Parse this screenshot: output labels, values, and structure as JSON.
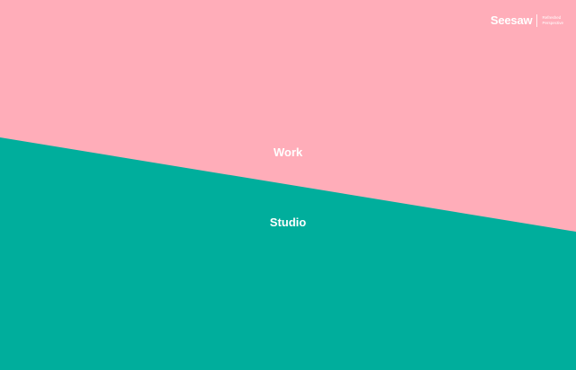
{
  "colors": {
    "pink": "#ffadb9",
    "teal": "#00ae9c",
    "text": "#ffffff"
  },
  "brand": {
    "name": "Seesaw",
    "tagline_line1": "Refreshed",
    "tagline_line2": "Perspective"
  },
  "nav": {
    "work_label": "Work",
    "studio_label": "Studio"
  }
}
